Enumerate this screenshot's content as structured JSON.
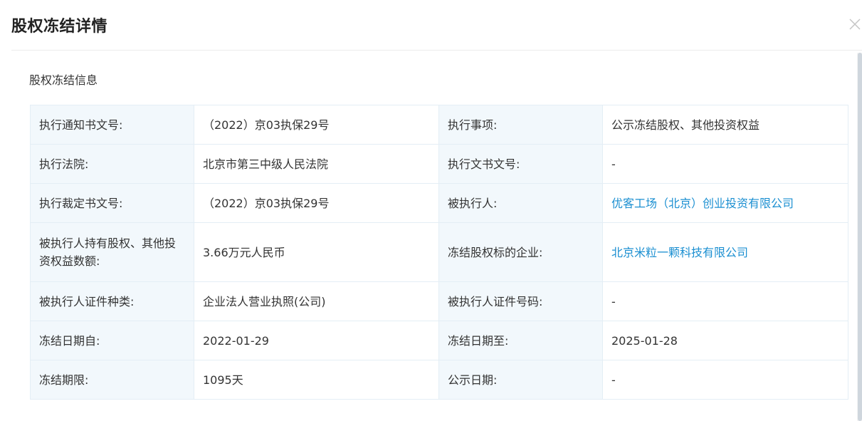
{
  "dialog": {
    "title": "股权冻结详情",
    "close_icon": "close-icon"
  },
  "section": {
    "title": "股权冻结信息"
  },
  "rows": [
    {
      "label1": "执行通知书文号:",
      "value1": "（2022）京03执保29号",
      "label2": "执行事项:",
      "value2": "公示冻结股权、其他投资权益"
    },
    {
      "label1": "执行法院:",
      "value1": "北京市第三中级人民法院",
      "label2": "执行文书文号:",
      "value2": "-"
    },
    {
      "label1": "执行裁定书文号:",
      "value1": "（2022）京03执保29号",
      "label2": "被执行人:",
      "value2": "优客工场（北京）创业投资有限公司"
    },
    {
      "label1": "被执行人持有股权、其他投资权益数额:",
      "value1": "3.66万元人民币",
      "label2": "冻结股权标的企业:",
      "value2": "北京米粒一颗科技有限公司"
    },
    {
      "label1": "被执行人证件种类:",
      "value1": "企业法人营业执照(公司)",
      "label2": "被执行人证件号码:",
      "value2": "-"
    },
    {
      "label1": "冻结日期自:",
      "value1": "2022-01-29",
      "label2": "冻结日期至:",
      "value2": "2025-01-28"
    },
    {
      "label1": "冻结期限:",
      "value1": "1095天",
      "label2": "公示日期:",
      "value2": "-"
    }
  ],
  "colors": {
    "label_bg": "#f2f8fc",
    "border": "#e4eef5",
    "link": "#1b8fd1"
  }
}
